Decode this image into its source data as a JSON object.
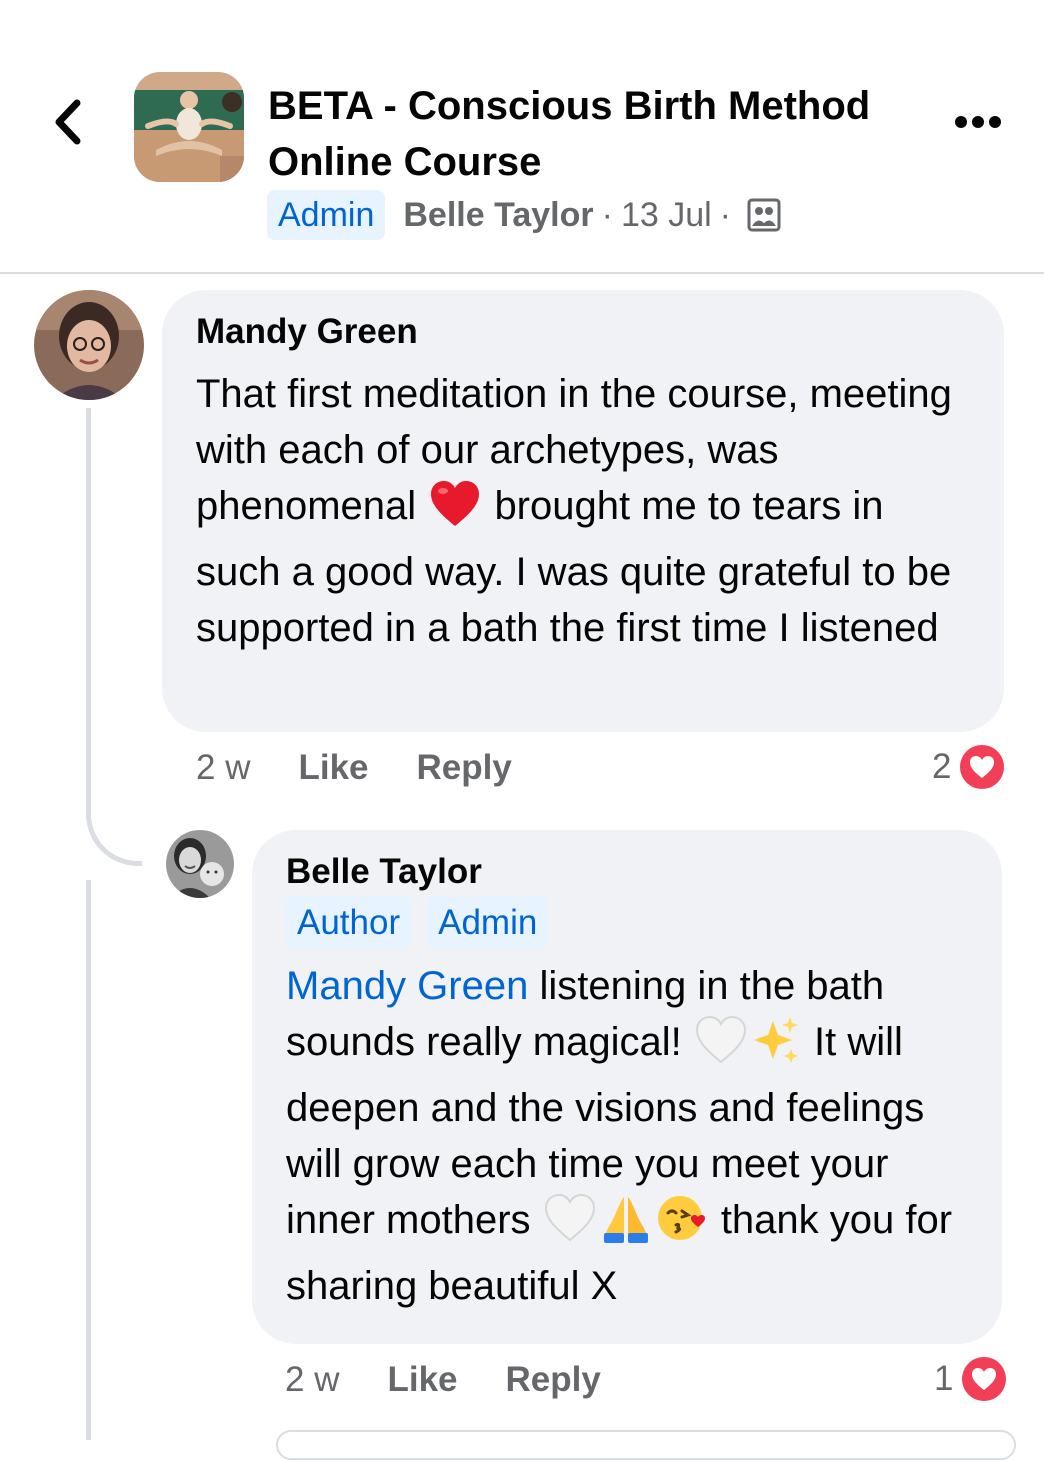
{
  "header": {
    "group_title": "BETA - Conscious Birth Method Online Course",
    "admin_badge": "Admin",
    "poster_name": "Belle Taylor",
    "separator": "·",
    "date": "13 Jul",
    "privacy_icon": "members-group-icon",
    "back_icon": "chevron-left-icon",
    "more_icon": "more-horizontal-icon"
  },
  "comments": [
    {
      "author": "Mandy Green",
      "text_parts": [
        "That first meditation in the course, meeting with each of our archetypes, was phenomenal",
        "brought me to tears in such a good way. I was quite grateful to be supported in a bath the first time I listened"
      ],
      "emoji": [
        "red-heart"
      ],
      "time": "2 w",
      "like_label": "Like",
      "reply_label": "Reply",
      "reaction_count": "2",
      "reaction_icon": "love-reaction-icon"
    },
    {
      "author": "Belle Taylor",
      "badges": [
        "Author",
        "Admin"
      ],
      "mention": "Mandy Green",
      "text_parts": [
        "listening in the bath sounds really magical!",
        "It will deepen and the visions and feelings will grow each time you meet your inner mothers",
        "thank you for sharing beautiful X"
      ],
      "emoji": [
        "white-heart",
        "sparkles",
        "white-heart",
        "folded-hands",
        "face-blowing-kiss"
      ],
      "time": "2 w",
      "like_label": "Like",
      "reply_label": "Reply",
      "reaction_count": "1",
      "reaction_icon": "love-reaction-icon"
    }
  ],
  "colors": {
    "accent_blue": "#0064d1",
    "badge_bg": "#e7f3ff",
    "bubble_bg": "#f0f2f5",
    "secondary_text": "#65676b",
    "love_red": "#f33e58"
  }
}
